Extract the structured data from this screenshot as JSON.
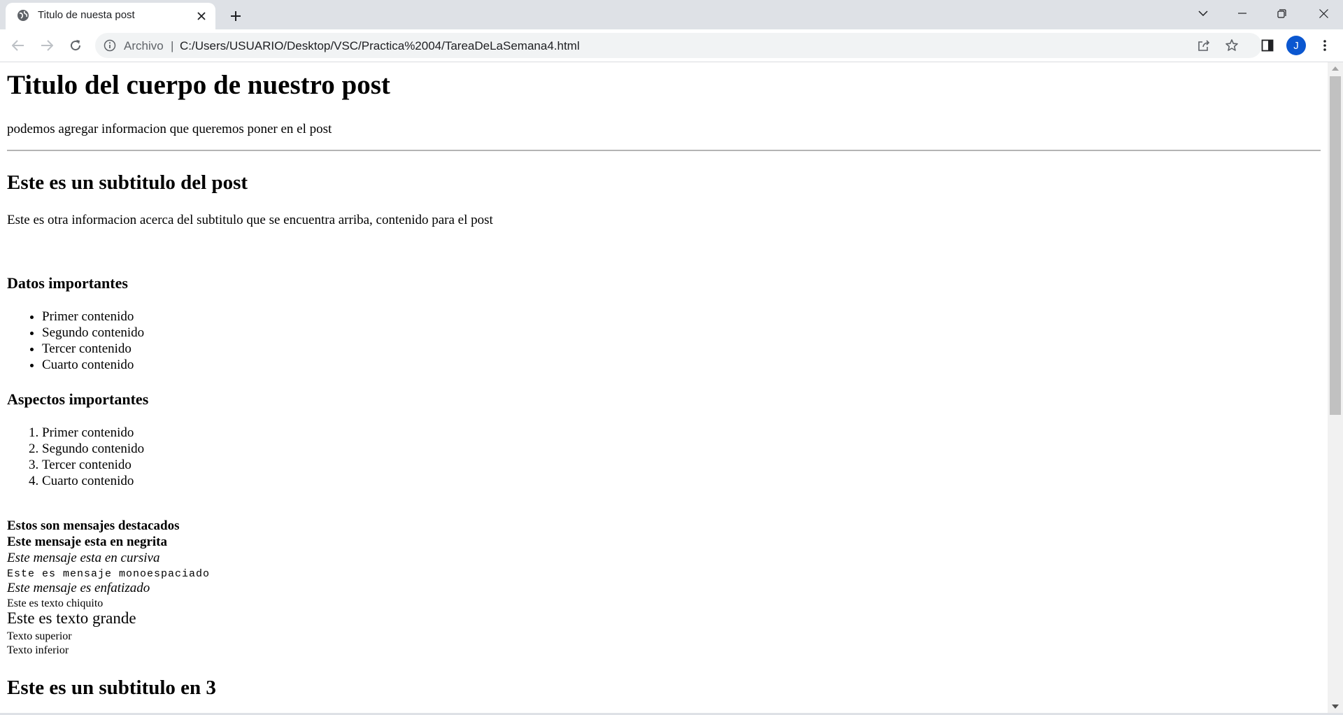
{
  "browser": {
    "tab_title": "Titulo de nuesta post",
    "address_scheme": "Archivo",
    "address_separator": "|",
    "address_url": "C:/Users/USUARIO/Desktop/VSC/Practica%2004/TareaDeLaSemana4.html",
    "profile_initial": "J",
    "accent_color": "#0b57d0"
  },
  "page": {
    "title": "Titulo del cuerpo de nuestro post",
    "intro": "podemos agregar informacion que queremos poner en el post",
    "subtitle": "Este es un subtitulo del post",
    "subtitle_text": "Este es otra informacion acerca del subtitulo que se encuentra arriba, contenido para el post",
    "datos_heading": "Datos importantes",
    "datos_items": [
      "Primer contenido",
      "Segundo contenido",
      "Tercer contenido",
      "Cuarto contenido"
    ],
    "aspectos_heading": "Aspectos importantes",
    "aspectos_items": [
      "Primer contenido",
      "Segundo contenido",
      "Tercer contenido",
      "Cuarto contenido"
    ],
    "highlighted": "Estos son mensajes destacados",
    "bold": "Este mensaje esta en negrita",
    "italic": "Este mensaje esta en cursiva",
    "monospace": "Este es mensaje monoespaciado",
    "emphasized": "Este mensaje es enfatizado",
    "small_text": "Este es texto chiquito",
    "big_text": "Este es texto grande",
    "superior": "Texto superior",
    "inferior": "Texto inferior",
    "subtitle3": "Este es un subtitulo en 3"
  }
}
